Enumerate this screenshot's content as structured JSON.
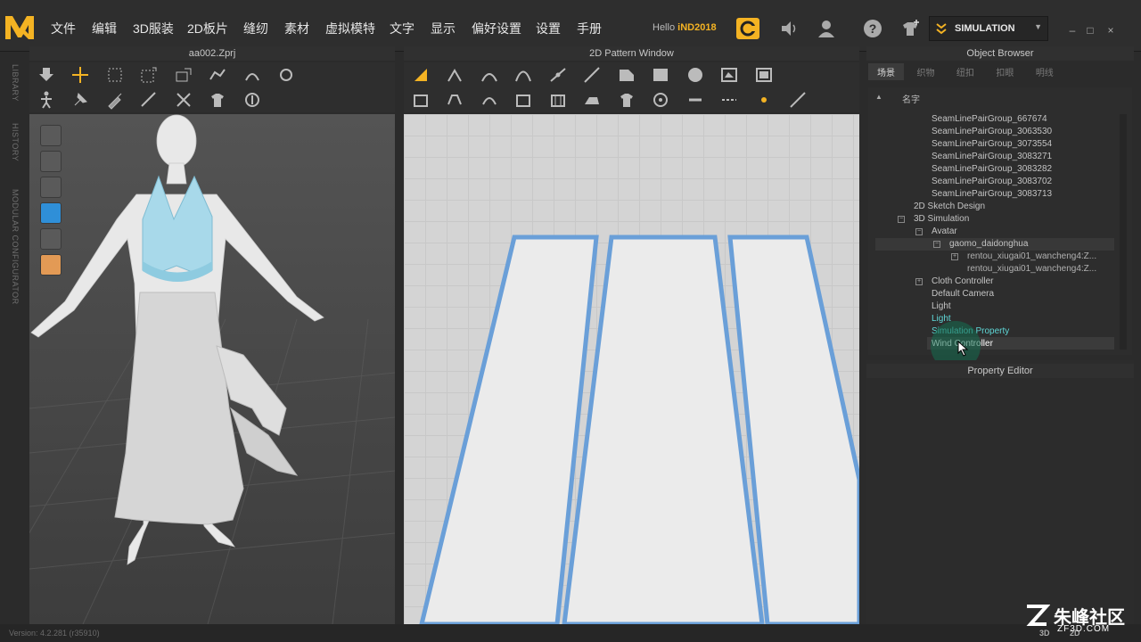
{
  "menu": [
    "文件",
    "编辑",
    "3D服装",
    "2D板片",
    "缝纫",
    "素材",
    "虚拟模特",
    "文字",
    "显示",
    "偏好设置",
    "设置",
    "手册"
  ],
  "user": {
    "prefix": "Hello",
    "name": "iND2018"
  },
  "mode": {
    "label": "SIMULATION"
  },
  "window_controls": [
    "–",
    "□",
    "×"
  ],
  "side_tabs": [
    "LIBRARY",
    "HISTORY",
    "MODULAR CONFIGURATOR"
  ],
  "panel3d": {
    "title": "aa002.Zprj"
  },
  "panel2d": {
    "title": "2D Pattern Window"
  },
  "object_browser": {
    "title": "Object Browser",
    "tabs": [
      "场景",
      "织物",
      "纽扣",
      "扣眼",
      "明线"
    ],
    "column": "名字",
    "items": [
      "SeamLinePairGroup_667674",
      "SeamLinePairGroup_3063530",
      "SeamLinePairGroup_3073554",
      "SeamLinePairGroup_3083271",
      "SeamLinePairGroup_3083282",
      "SeamLinePairGroup_3083702",
      "SeamLinePairGroup_3083713",
      "2D Sketch Design",
      "3D Simulation",
      "Avatar",
      "gaomo_daidonghua",
      "rentou_xiugai01_wancheng4:Z...",
      "rentou_xiugai01_wancheng4:Z...",
      "Cloth Controller",
      "Default Camera",
      "Light",
      "Light",
      "Simulation Property",
      "Wind Controller"
    ]
  },
  "property_editor": {
    "title": "Property Editor"
  },
  "status": {
    "version": "Version: 4.2.281 (r35910)",
    "view_buttons": [
      "3D",
      "2D"
    ]
  },
  "watermark": {
    "main": "朱峰社区",
    "sub": "ZF3D.COM"
  },
  "colors": {
    "accent": "#f4b323",
    "highlight": "#5fd7d7",
    "pattern_outline": "#6a9fd8"
  }
}
